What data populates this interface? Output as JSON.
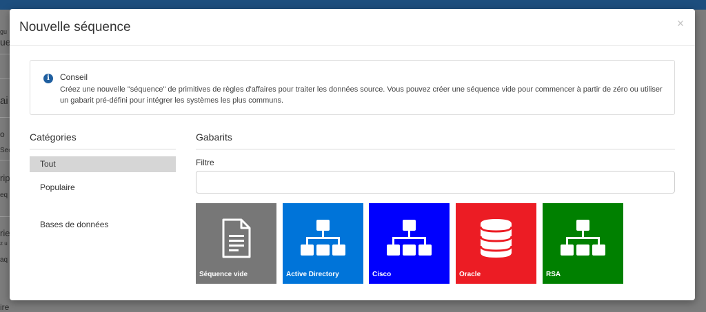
{
  "background": {
    "snippets": [
      "gu",
      "ue",
      "ai",
      "o",
      "Sec",
      "rip",
      "eq",
      "rie",
      "z u",
      "aq",
      "ire"
    ]
  },
  "modal": {
    "title": "Nouvelle séquence",
    "close_label": "×"
  },
  "tip": {
    "title": "Conseil",
    "text": "Créez une nouvelle \"séquence\" de primitives de règles d'affaires pour traiter les données source. Vous pouvez créer une séquence vide pour commencer à partir de zéro ou utiliser un gabarit pré-défini pour intégrer les systèmes les plus communs."
  },
  "categories": {
    "heading": "Catégories",
    "items": [
      {
        "label": "Tout",
        "active": true
      },
      {
        "label": "Populaire",
        "active": false
      },
      {
        "label": "Bases de données",
        "active": false
      }
    ]
  },
  "templates": {
    "heading": "Gabarits",
    "filter_label": "Filtre",
    "filter_value": "",
    "tiles": [
      {
        "label": "Séquence vide",
        "icon": "document-icon",
        "color": "#777777"
      },
      {
        "label": "Active Directory",
        "icon": "hierarchy-icon",
        "color": "#0074d9"
      },
      {
        "label": "Cisco",
        "icon": "hierarchy-icon",
        "color": "#0000fe"
      },
      {
        "label": "Oracle",
        "icon": "database-icon",
        "color": "#ec1c24"
      },
      {
        "label": "RSA",
        "icon": "hierarchy-icon",
        "color": "#008000"
      }
    ]
  }
}
